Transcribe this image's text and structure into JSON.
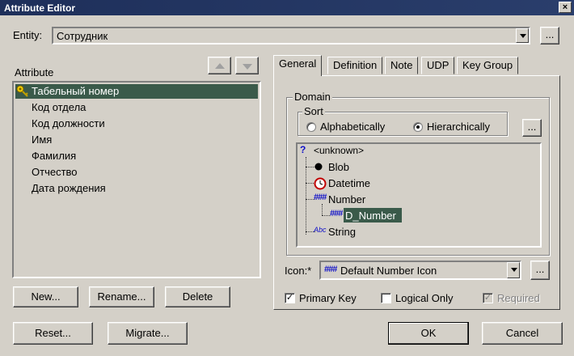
{
  "window": {
    "title": "Attribute Editor",
    "close_glyph": "×"
  },
  "entity": {
    "label": "Entity:",
    "value": "Сотрудник",
    "browse_label": "..."
  },
  "attributes": {
    "label": "Attribute",
    "items": [
      {
        "text": "Табельный номер",
        "selected": true,
        "key": true
      },
      {
        "text": "Код отдела"
      },
      {
        "text": "Код должности"
      },
      {
        "text": "Имя"
      },
      {
        "text": "Фамилия"
      },
      {
        "text": "Отчество"
      },
      {
        "text": "Дата рождения"
      }
    ],
    "buttons": {
      "new": "New...",
      "rename": "Rename...",
      "delete": "Delete"
    }
  },
  "tabs": [
    {
      "label": "General",
      "active": true
    },
    {
      "label": "Definition"
    },
    {
      "label": "Note"
    },
    {
      "label": "UDP"
    },
    {
      "label": "Key Group"
    }
  ],
  "domain": {
    "group_label": "Domain",
    "sort": {
      "group_label": "Sort",
      "options": [
        {
          "label": "Alphabetically",
          "checked": false
        },
        {
          "label": "Hierarchically",
          "checked": true
        }
      ],
      "browse_label": "..."
    },
    "tree": [
      {
        "label": "<unknown>",
        "icon": "question-icon",
        "level": 0
      },
      {
        "label": "Blob",
        "icon": "dot-icon",
        "level": 1
      },
      {
        "label": "Datetime",
        "icon": "clock-icon",
        "level": 1
      },
      {
        "label": "Number",
        "icon": "number-icon",
        "level": 1
      },
      {
        "label": "D_Number",
        "icon": "number-icon",
        "level": 2,
        "selected": true
      },
      {
        "label": "String",
        "icon": "string-icon",
        "level": 1
      }
    ]
  },
  "icon_field": {
    "label": "Icon:*",
    "value": "Default Number Icon",
    "browse_label": "..."
  },
  "options": {
    "primary_key": {
      "label": "Primary Key",
      "checked": true
    },
    "logical_only": {
      "label": "Logical Only",
      "checked": false
    },
    "required": {
      "label": "Required",
      "checked": true,
      "disabled": true
    }
  },
  "footer": {
    "reset": "Reset...",
    "migrate": "Migrate...",
    "ok": "OK",
    "cancel": "Cancel"
  },
  "colors": {
    "selection": "#3a5a4a",
    "title_bar": "#1e2f5a",
    "icon_blue": "#1010c8"
  }
}
